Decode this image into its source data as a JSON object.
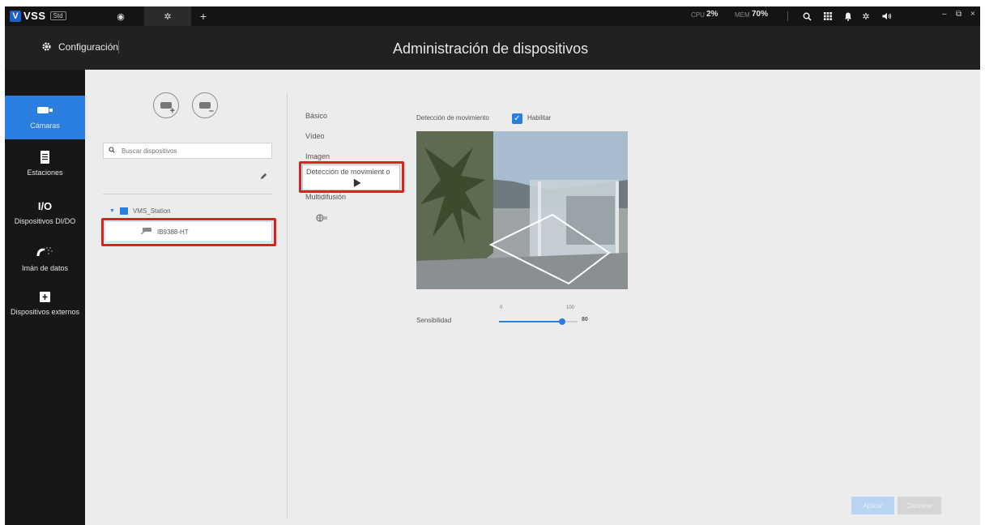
{
  "app": {
    "logo_mark": "V",
    "name": "VSS",
    "edition": "Std"
  },
  "tabs": [
    {
      "icon": "eye-icon",
      "glyph": "◉"
    },
    {
      "icon": "gear-icon",
      "glyph": "✲"
    },
    {
      "icon": "plus-icon",
      "glyph": "+"
    }
  ],
  "perf": {
    "cpu_label": "CPU",
    "cpu_value": "2%",
    "mem_label": "MEM",
    "mem_value": "70%"
  },
  "header": {
    "section": "Configuración",
    "title": "Administración de dispositivos"
  },
  "sidebar": {
    "items": [
      {
        "label": "Cámaras",
        "icon": "camera-icon"
      },
      {
        "label": "Estaciones",
        "icon": "server-icon"
      },
      {
        "label": "Dispositivos DI/DO",
        "icon": "io-icon",
        "glyph": "I/O"
      },
      {
        "label": "Imán de datos",
        "icon": "magnet-icon"
      },
      {
        "label": "Dispositivos externos",
        "icon": "external-device-icon"
      }
    ]
  },
  "device_tree": {
    "search_placeholder": "Buscar dispositivos",
    "station": "VMS_Station",
    "device": "IB9388-HT"
  },
  "settings_nav": {
    "items": [
      "Básico",
      "Vídeo",
      "Imagen",
      "Detección de movimient o",
      "Multidifusión"
    ],
    "active_index": 3
  },
  "motion": {
    "label": "Detección de movimiento",
    "enable_label": "Habilitar",
    "enabled": true,
    "sensitivity_label": "Sensibilidad",
    "slider_min": "0",
    "slider_max": "100",
    "sensitivity_value": "80",
    "sensitivity_fraction": 0.8
  },
  "buttons": {
    "apply": "Aplicar",
    "cancel": "Cancelar"
  },
  "colors": {
    "accent": "#2a7ee0",
    "highlight": "#e02020",
    "titlebar": "#141414",
    "sidebar": "#171717"
  }
}
